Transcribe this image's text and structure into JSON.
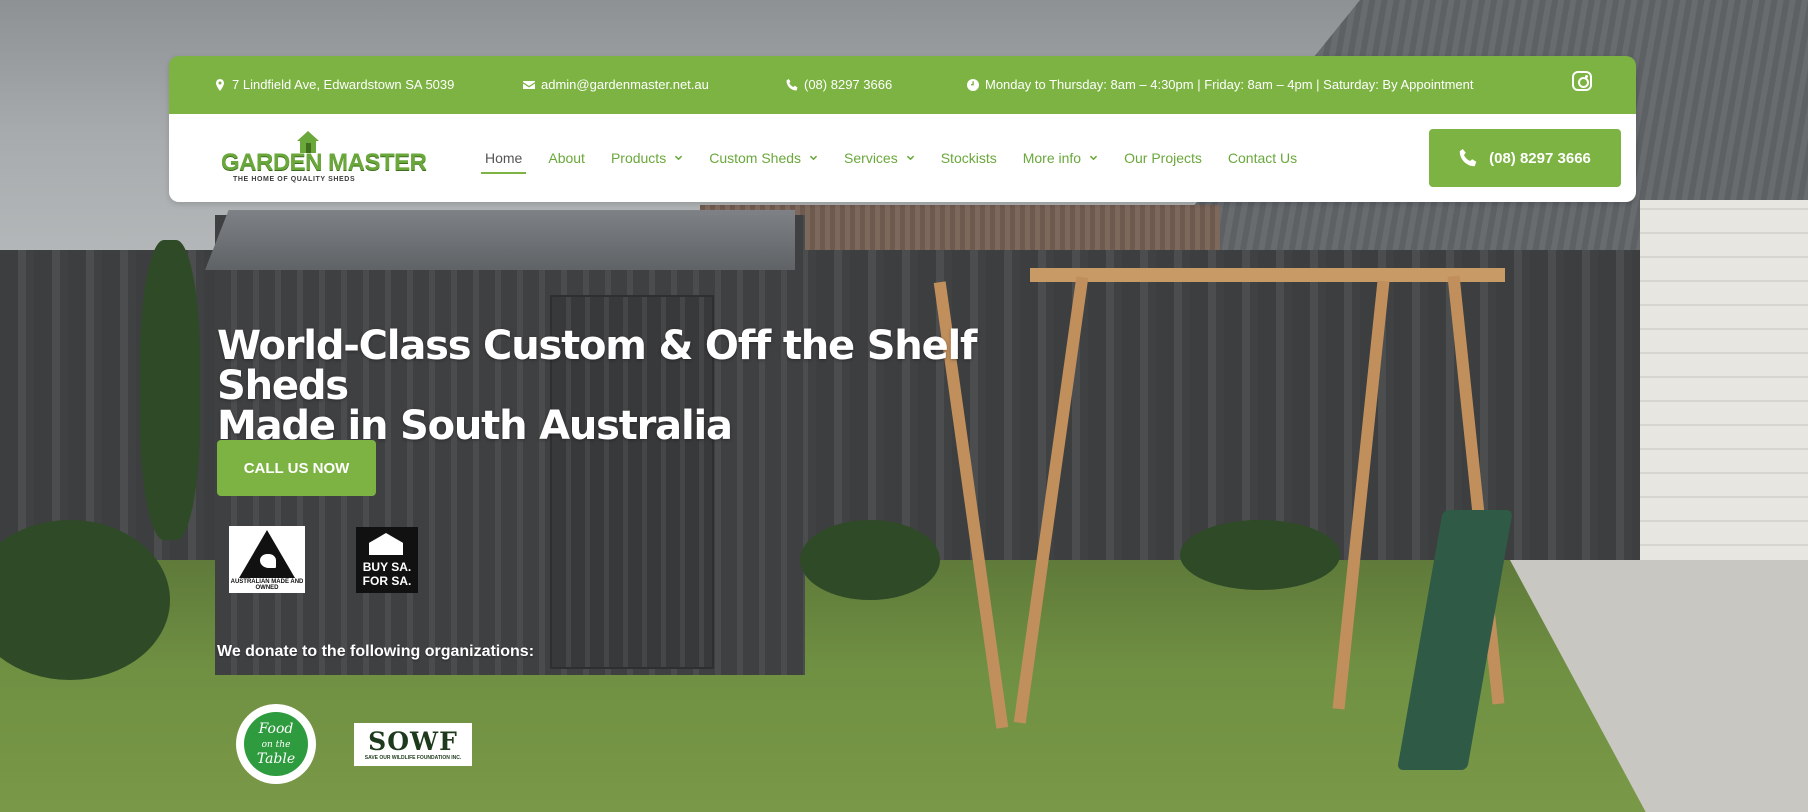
{
  "topbar": {
    "address": "7 Lindfield Ave, Edwardstown SA 5039",
    "email": "admin@gardenmaster.net.au",
    "phone": "(08) 8297 3666",
    "hours": "Monday to Thursday: 8am – 4:30pm | Friday: 8am – 4pm | Saturday: By Appointment",
    "icons": [
      "map-marker-icon",
      "envelope-icon",
      "phone-icon",
      "clock-icon",
      "instagram-icon"
    ]
  },
  "logo": {
    "name": "GARDEN MASTER",
    "tagline": "THE HOME OF QUALITY SHEDS"
  },
  "nav": {
    "items": [
      {
        "label": "Home",
        "active": true,
        "dropdown": false
      },
      {
        "label": "About",
        "active": false,
        "dropdown": false
      },
      {
        "label": "Products",
        "active": false,
        "dropdown": true
      },
      {
        "label": "Custom Sheds",
        "active": false,
        "dropdown": true
      },
      {
        "label": "Services",
        "active": false,
        "dropdown": true
      },
      {
        "label": "Stockists",
        "active": false,
        "dropdown": false
      },
      {
        "label": "More info",
        "active": false,
        "dropdown": true
      },
      {
        "label": "Our Projects",
        "active": false,
        "dropdown": false
      },
      {
        "label": "Contact Us",
        "active": false,
        "dropdown": false
      }
    ],
    "call_button": "(08) 8297 3666"
  },
  "hero": {
    "title_line1": "World-Class Custom & Off the Shelf Sheds",
    "title_line2": "Made in South Australia",
    "cta": "CALL US NOW",
    "badge_australian": "AUSTRALIAN MADE AND OWNED",
    "badge_buysa_line1": "BUY SA.",
    "badge_buysa_line2": "FOR SA.",
    "donate_text": "We donate to the following organizations:",
    "org1_line1": "Food",
    "org1_line2": "on the",
    "org1_line3": "Table",
    "org2_name": "SOWF",
    "org2_sub": "SAVE OUR WILDLIFE FOUNDATION INC."
  },
  "colors": {
    "brand_green": "#7cb342",
    "nav_text": "#6aa83b",
    "active_text": "#555555",
    "white": "#ffffff"
  }
}
